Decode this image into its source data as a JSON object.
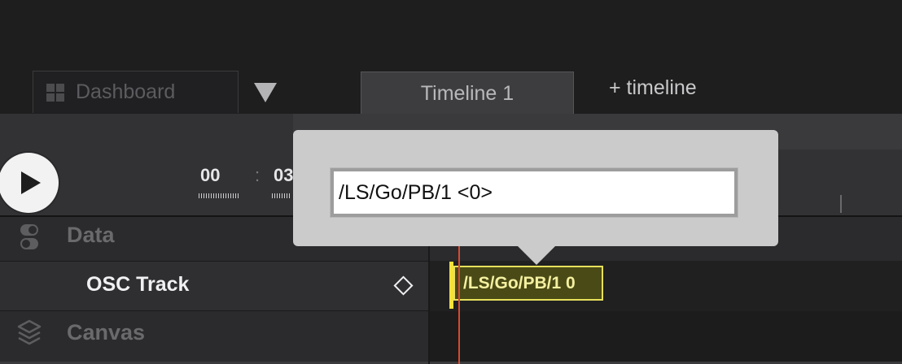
{
  "tabs": {
    "dashboard": "Dashboard",
    "timeline": "Timeline 1",
    "add_timeline": "+ timeline"
  },
  "transport": {
    "timecode_hours": "00",
    "timecode_sep": ":",
    "timecode_minutes": "03"
  },
  "tracks": {
    "data_group": "Data",
    "osc_track": "OSC Track",
    "canvas_group": "Canvas"
  },
  "clip": {
    "label": "/LS/Go/PB/1 0"
  },
  "popover": {
    "input_value": "/LS/Go/PB/1 <0>"
  },
  "colors": {
    "background": "#1e1e1f",
    "clip_border": "#e6e05a",
    "playhead": "#d84a32",
    "popover": "#cbcbcb"
  },
  "icons": {
    "dashboard": "grid-icon",
    "dropdown": "triangle-down-icon",
    "play": "play-icon",
    "data": "toggle-icon",
    "keyframe": "diamond-icon",
    "canvas": "layers-icon"
  }
}
